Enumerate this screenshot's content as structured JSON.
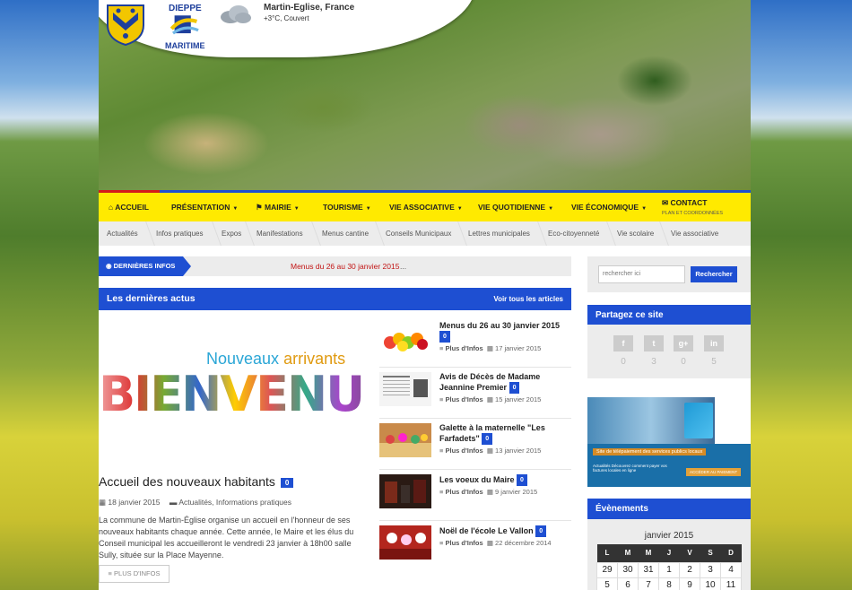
{
  "header": {
    "city": "Martin-Eglise, France",
    "weather": "+3°C, Couvert",
    "logo_dieppe_top": "DIEPPE",
    "logo_dieppe_bottom": "MARITIME"
  },
  "main_nav": {
    "items": [
      "ACCUEIL",
      "PRÉSENTATION",
      "MAIRIE",
      "TOURISME",
      "VIE ASSOCIATIVE",
      "VIE QUOTIDIENNE",
      "VIE ÉCONOMIQUE"
    ],
    "contact_label": "CONTACT",
    "contact_sub": "PLAN ET COORDONNÉES"
  },
  "sub_nav": {
    "items": [
      "Actualités",
      "Infos pratiques",
      "Expos",
      "Manifestations",
      "Menus cantine",
      "Conseils Municipaux",
      "Lettres municipales",
      "Eco-citoyenneté",
      "Vie scolaire",
      "Vie associative"
    ]
  },
  "ticker": {
    "label": "DERNIÈRES INFOS",
    "text": "Menus du 26 au 30 janvier 2015",
    "dots": "..."
  },
  "news": {
    "heading": "Les dernières actus",
    "see_all": "Voir tous les articles",
    "feature": {
      "image_line1_a": "Nouveaux",
      "image_line1_b": "arrivants",
      "image_word": "BIENVENUE",
      "title": "Accueil des nouveaux habitants",
      "comments": "0",
      "date": "18 janvier 2015",
      "categories": "Actualités, Informations pratiques",
      "excerpt": "La commune de Martin-Église organise un accueil en l'honneur de ses nouveaux habitants chaque année. Cette année, le Maire et les élus du Conseil municipal les accueilleront le vendredi 23 janvier à 18h00 salle Sully, située sur la Place Mayenne.",
      "more": "PLUS D'INFOS"
    },
    "side": [
      {
        "title": "Menus du 26 au 30 janvier 2015",
        "comments": "0",
        "more": "Plus d'Infos",
        "date": "17 janvier 2015"
      },
      {
        "title": "Avis de Décès de Madame Jeannine Premier",
        "comments": "0",
        "more": "Plus d'Infos",
        "date": "15 janvier 2015"
      },
      {
        "title": "Galette à la maternelle \"Les Farfadets\"",
        "comments": "0",
        "more": "Plus d'Infos",
        "date": "13 janvier 2015"
      },
      {
        "title": "Les voeux du Maire",
        "comments": "0",
        "more": "Plus d'Infos",
        "date": "9 janvier 2015"
      },
      {
        "title": "Noël de l'école Le Vallon",
        "comments": "0",
        "more": "Plus d'Infos",
        "date": "22 décembre 2014"
      }
    ]
  },
  "search": {
    "placeholder": "rechercher ici",
    "button": "Rechercher"
  },
  "share": {
    "heading": "Partagez ce site",
    "buttons": [
      {
        "glyph": "f",
        "count": "0"
      },
      {
        "glyph": "t",
        "count": "3"
      },
      {
        "glyph": "g+",
        "count": "0"
      },
      {
        "glyph": "in",
        "count": "5"
      }
    ]
  },
  "ad": {
    "title": "Site de télépaiement des services publics locaux",
    "sub": "Actualités Découvrez comment payer vos factures locales en ligne",
    "button": "ACCÉDER AU PAIEMENT"
  },
  "events": {
    "heading": "Évènements",
    "month": "janvier 2015",
    "days": [
      "L",
      "M",
      "M",
      "J",
      "V",
      "S",
      "D"
    ],
    "weeks": [
      [
        "29",
        "30",
        "31",
        "1",
        "2",
        "3",
        "4"
      ],
      [
        "5",
        "6",
        "7",
        "8",
        "9",
        "10",
        "11"
      ]
    ]
  }
}
